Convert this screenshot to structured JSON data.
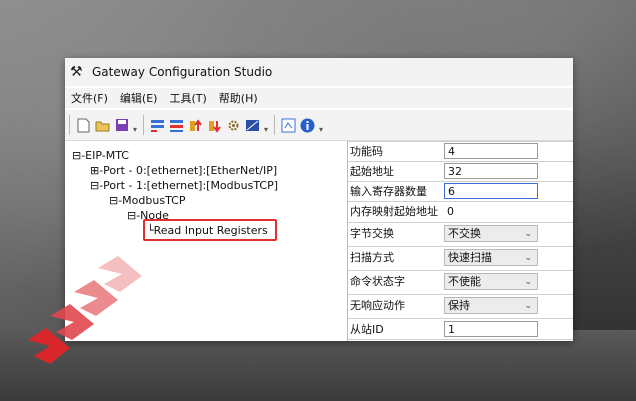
{
  "window": {
    "title": "Gateway Configuration Studio",
    "title_icon": "tools-icon"
  },
  "menu": [
    "文件(F)",
    "编辑(E)",
    "工具(T)",
    "帮助(H)"
  ],
  "toolbar": {
    "icons": [
      "new-file-icon",
      "open-folder-icon",
      "save-icon",
      "add-device-icon",
      "delete-device-icon",
      "upload-icon",
      "download-icon",
      "settings-icon",
      "monitor-icon",
      "config-icon",
      "info-icon"
    ]
  },
  "tree": {
    "nodes": [
      {
        "label": "⊟-EIP-MTC"
      },
      {
        "label": "⊞-Port - 0:[ethernet]:[EtherNet/IP]"
      },
      {
        "label": "⊟-Port - 1:[ethernet]:[ModbusTCP]"
      },
      {
        "label": "⊟-ModbusTCP"
      },
      {
        "label": "⊟-Node"
      },
      {
        "label": "└Read Input Registers"
      }
    ]
  },
  "properties": {
    "rows": [
      {
        "name": "功能码",
        "value": "4",
        "kind": "input"
      },
      {
        "name": "起始地址",
        "value": "32",
        "kind": "input"
      },
      {
        "name": "输入寄存器数量",
        "value": "6",
        "kind": "input-active"
      },
      {
        "name": "内存映射起始地址",
        "value": "0",
        "kind": "text"
      },
      {
        "name": "字节交换",
        "value": "不交换",
        "kind": "select"
      },
      {
        "name": "扫描方式",
        "value": "快速扫描",
        "kind": "select"
      },
      {
        "name": "命令状态字",
        "value": "不使能",
        "kind": "select"
      },
      {
        "name": "无响应动作",
        "value": "保持",
        "kind": "select"
      },
      {
        "name": "从站ID",
        "value": "1",
        "kind": "input"
      }
    ]
  },
  "colors": {
    "highlight": "#e03030",
    "chevron": "#e83a3a"
  }
}
